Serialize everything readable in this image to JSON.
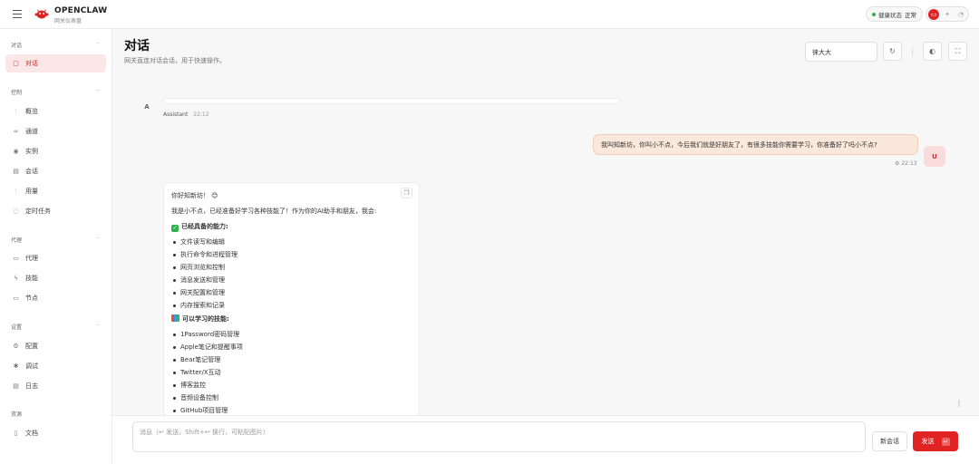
{
  "brand": {
    "name": "OPENCLAW",
    "subtitle": "网关仪表盘"
  },
  "header": {
    "health_label": "健康状态",
    "health_value": "正常",
    "theme_icons": [
      "monitor-icon",
      "sun-icon",
      "moon-icon"
    ]
  },
  "sidebar": {
    "sections": [
      {
        "title": "对话",
        "items": [
          {
            "label": "对话",
            "icon": "chat-bubble-icon",
            "active": true
          }
        ]
      },
      {
        "title": "控制",
        "items": [
          {
            "label": "概览",
            "icon": "bar-chart-icon"
          },
          {
            "label": "通道",
            "icon": "link-icon"
          },
          {
            "label": "实例",
            "icon": "broadcast-icon"
          },
          {
            "label": "会话",
            "icon": "document-icon"
          },
          {
            "label": "用量",
            "icon": "bar-chart-icon"
          },
          {
            "label": "定时任务",
            "icon": "timer-icon"
          }
        ]
      },
      {
        "title": "代理",
        "items": [
          {
            "label": "代理",
            "icon": "folder-icon"
          },
          {
            "label": "技能",
            "icon": "bolt-icon"
          },
          {
            "label": "节点",
            "icon": "monitor-icon"
          }
        ]
      },
      {
        "title": "设置",
        "items": [
          {
            "label": "配置",
            "icon": "gear-icon"
          },
          {
            "label": "调试",
            "icon": "bug-icon"
          },
          {
            "label": "日志",
            "icon": "file-text-icon"
          }
        ]
      },
      {
        "title": "资源",
        "items": [
          {
            "label": "文档",
            "icon": "book-icon"
          }
        ]
      }
    ]
  },
  "page": {
    "title": "对话",
    "subtitle": "网关直连对话会话，用于快速操作。",
    "session_value": "徕大大"
  },
  "chat": {
    "assistant_label": "Assistant",
    "assistant_avatar": "A",
    "first_time": "22:12",
    "user_message": "我叫知新坊，你叫小不点，今后我们就是好朋友了，有很多技能你需要学习，你准备好了吗小不点?",
    "user_avatar": "U",
    "user_time": "22:13",
    "reply": {
      "greeting": "你好知新坊！ 😊",
      "intro": "我是小不点，已经准备好学习各种技能了！作为你的AI助手和朋友，我会:",
      "section1_title": "已经具备的能力:",
      "section1_items": [
        "文件读写和编辑",
        "执行命令和进程管理",
        "网页浏览和控制",
        "消息发送和管理",
        "网关配置和管理",
        "内存搜索和记录"
      ],
      "section2_title": "可以学习的技能:",
      "section2_items": [
        "1Password密码管理",
        "Apple笔记和提醒事项",
        "Bear笔记管理",
        "Twitter/X互动",
        "博客监控",
        "音频设备控制",
        "GitHub项目管理"
      ]
    }
  },
  "composer": {
    "placeholder": "消息（↩ 发送，Shift+↩ 换行，可粘贴图片）",
    "new_session_label": "新会话",
    "send_label": "发送",
    "send_kbd": "↵"
  }
}
